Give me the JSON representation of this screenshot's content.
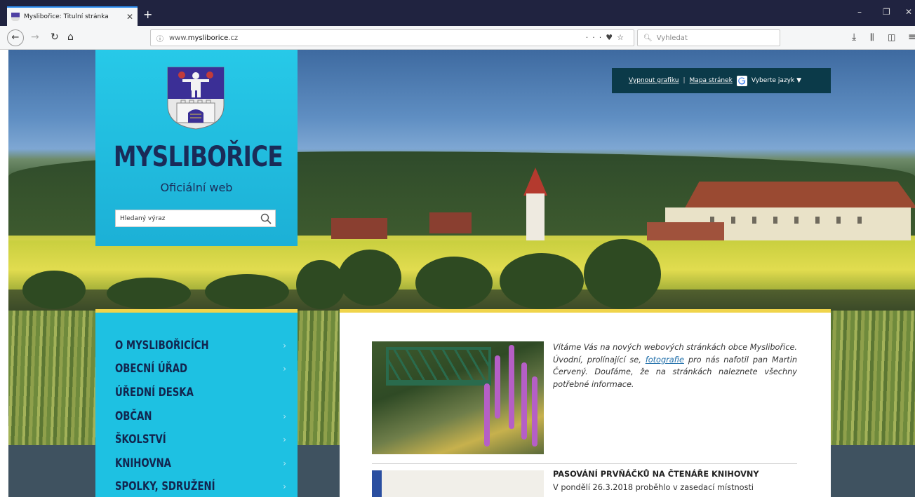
{
  "browser": {
    "tab_title": "Myslibořice: Titulní stránka",
    "tab_close": "✕",
    "new_tab": "+",
    "url_domain_prefix": "www.",
    "url_domain_main": "mysliborice",
    "url_domain_suffix": ".cz",
    "search_placeholder": "Vyhledat"
  },
  "site": {
    "name": "MYSLIBOŘICE",
    "subtitle": "Oficiální web",
    "search_placeholder": "Hledaný výraz"
  },
  "toplinks": {
    "graphics_off": "Vypnout grafiku",
    "separator": "|",
    "sitemap": "Mapa stránek",
    "language": "Vyberte jazyk ▼"
  },
  "menu": {
    "chevron": "›",
    "items": [
      {
        "label": "O MYSLIBOŘICÍCH",
        "has_sub": true
      },
      {
        "label": "OBECNÍ ÚŘAD",
        "has_sub": true
      },
      {
        "label": "ÚŘEDNÍ DESKA",
        "has_sub": false
      },
      {
        "label": "OBČAN",
        "has_sub": true
      },
      {
        "label": "ŠKOLSTVÍ",
        "has_sub": true
      },
      {
        "label": "KNIHOVNA",
        "has_sub": true
      },
      {
        "label": "SPOLKY, SDRUŽENÍ",
        "has_sub": true
      }
    ]
  },
  "news": {
    "intro_before": "Vítáme Vás na nových webových stránkách obce Myslibořice. Úvodní, prolínající se, ",
    "intro_link": "fotografie",
    "intro_after": " pro nás nafotil pan Martin Červený. Doufáme, že na stránkách naleznete všechny potřebné informace.",
    "item2_title": "PASOVÁNÍ PRVŇÁČKŮ NA ČTENÁŘE KNIHOVNY",
    "item2_text": "V pondělí 26.3.2018 proběhlo v zasedací místnosti"
  },
  "colors": {
    "panel": "#1ec1e2",
    "navy": "#1a2b58",
    "accent": "#f0d44b",
    "toplinks_bg": "#0b3a49"
  }
}
